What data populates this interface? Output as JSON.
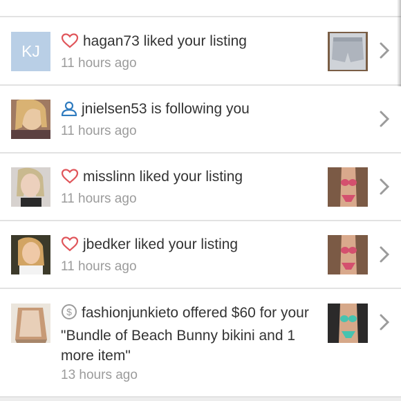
{
  "notifications": [
    {
      "avatar": {
        "type": "initials",
        "text": "KJ"
      },
      "icon": "heart-outline-icon",
      "message": "hagan73 liked your listing",
      "time": "11 hours ago",
      "thumbnail": "shorts-photo"
    },
    {
      "avatar": {
        "type": "photo",
        "text": ""
      },
      "icon": "person-outline-icon",
      "message": "jnielsen53 is following you",
      "time": "11 hours ago",
      "thumbnail": ""
    },
    {
      "avatar": {
        "type": "photo",
        "text": ""
      },
      "icon": "heart-outline-icon",
      "message": "misslinn liked your listing",
      "time": "11 hours ago",
      "thumbnail": "bikini-photo"
    },
    {
      "avatar": {
        "type": "photo",
        "text": ""
      },
      "icon": "heart-outline-icon",
      "message": "jbedker liked your listing",
      "time": "11 hours ago",
      "thumbnail": "bikini-photo"
    },
    {
      "avatar": {
        "type": "photo",
        "text": ""
      },
      "icon": "dollar-circle-icon",
      "message": "fashionjunkieto offered $60 for your \"Bundle of Beach Bunny bikini and 1 more item\"",
      "time": "13 hours ago",
      "thumbnail": "bikini-green-photo"
    }
  ],
  "colors": {
    "heart": "#e0555a",
    "person": "#2f7bbf",
    "dollar": "#9b9b9b",
    "initials_bg": "#b9cfe6",
    "divider": "#e2e2e2",
    "time_text": "#9b9b9b",
    "message_text": "#333333"
  }
}
